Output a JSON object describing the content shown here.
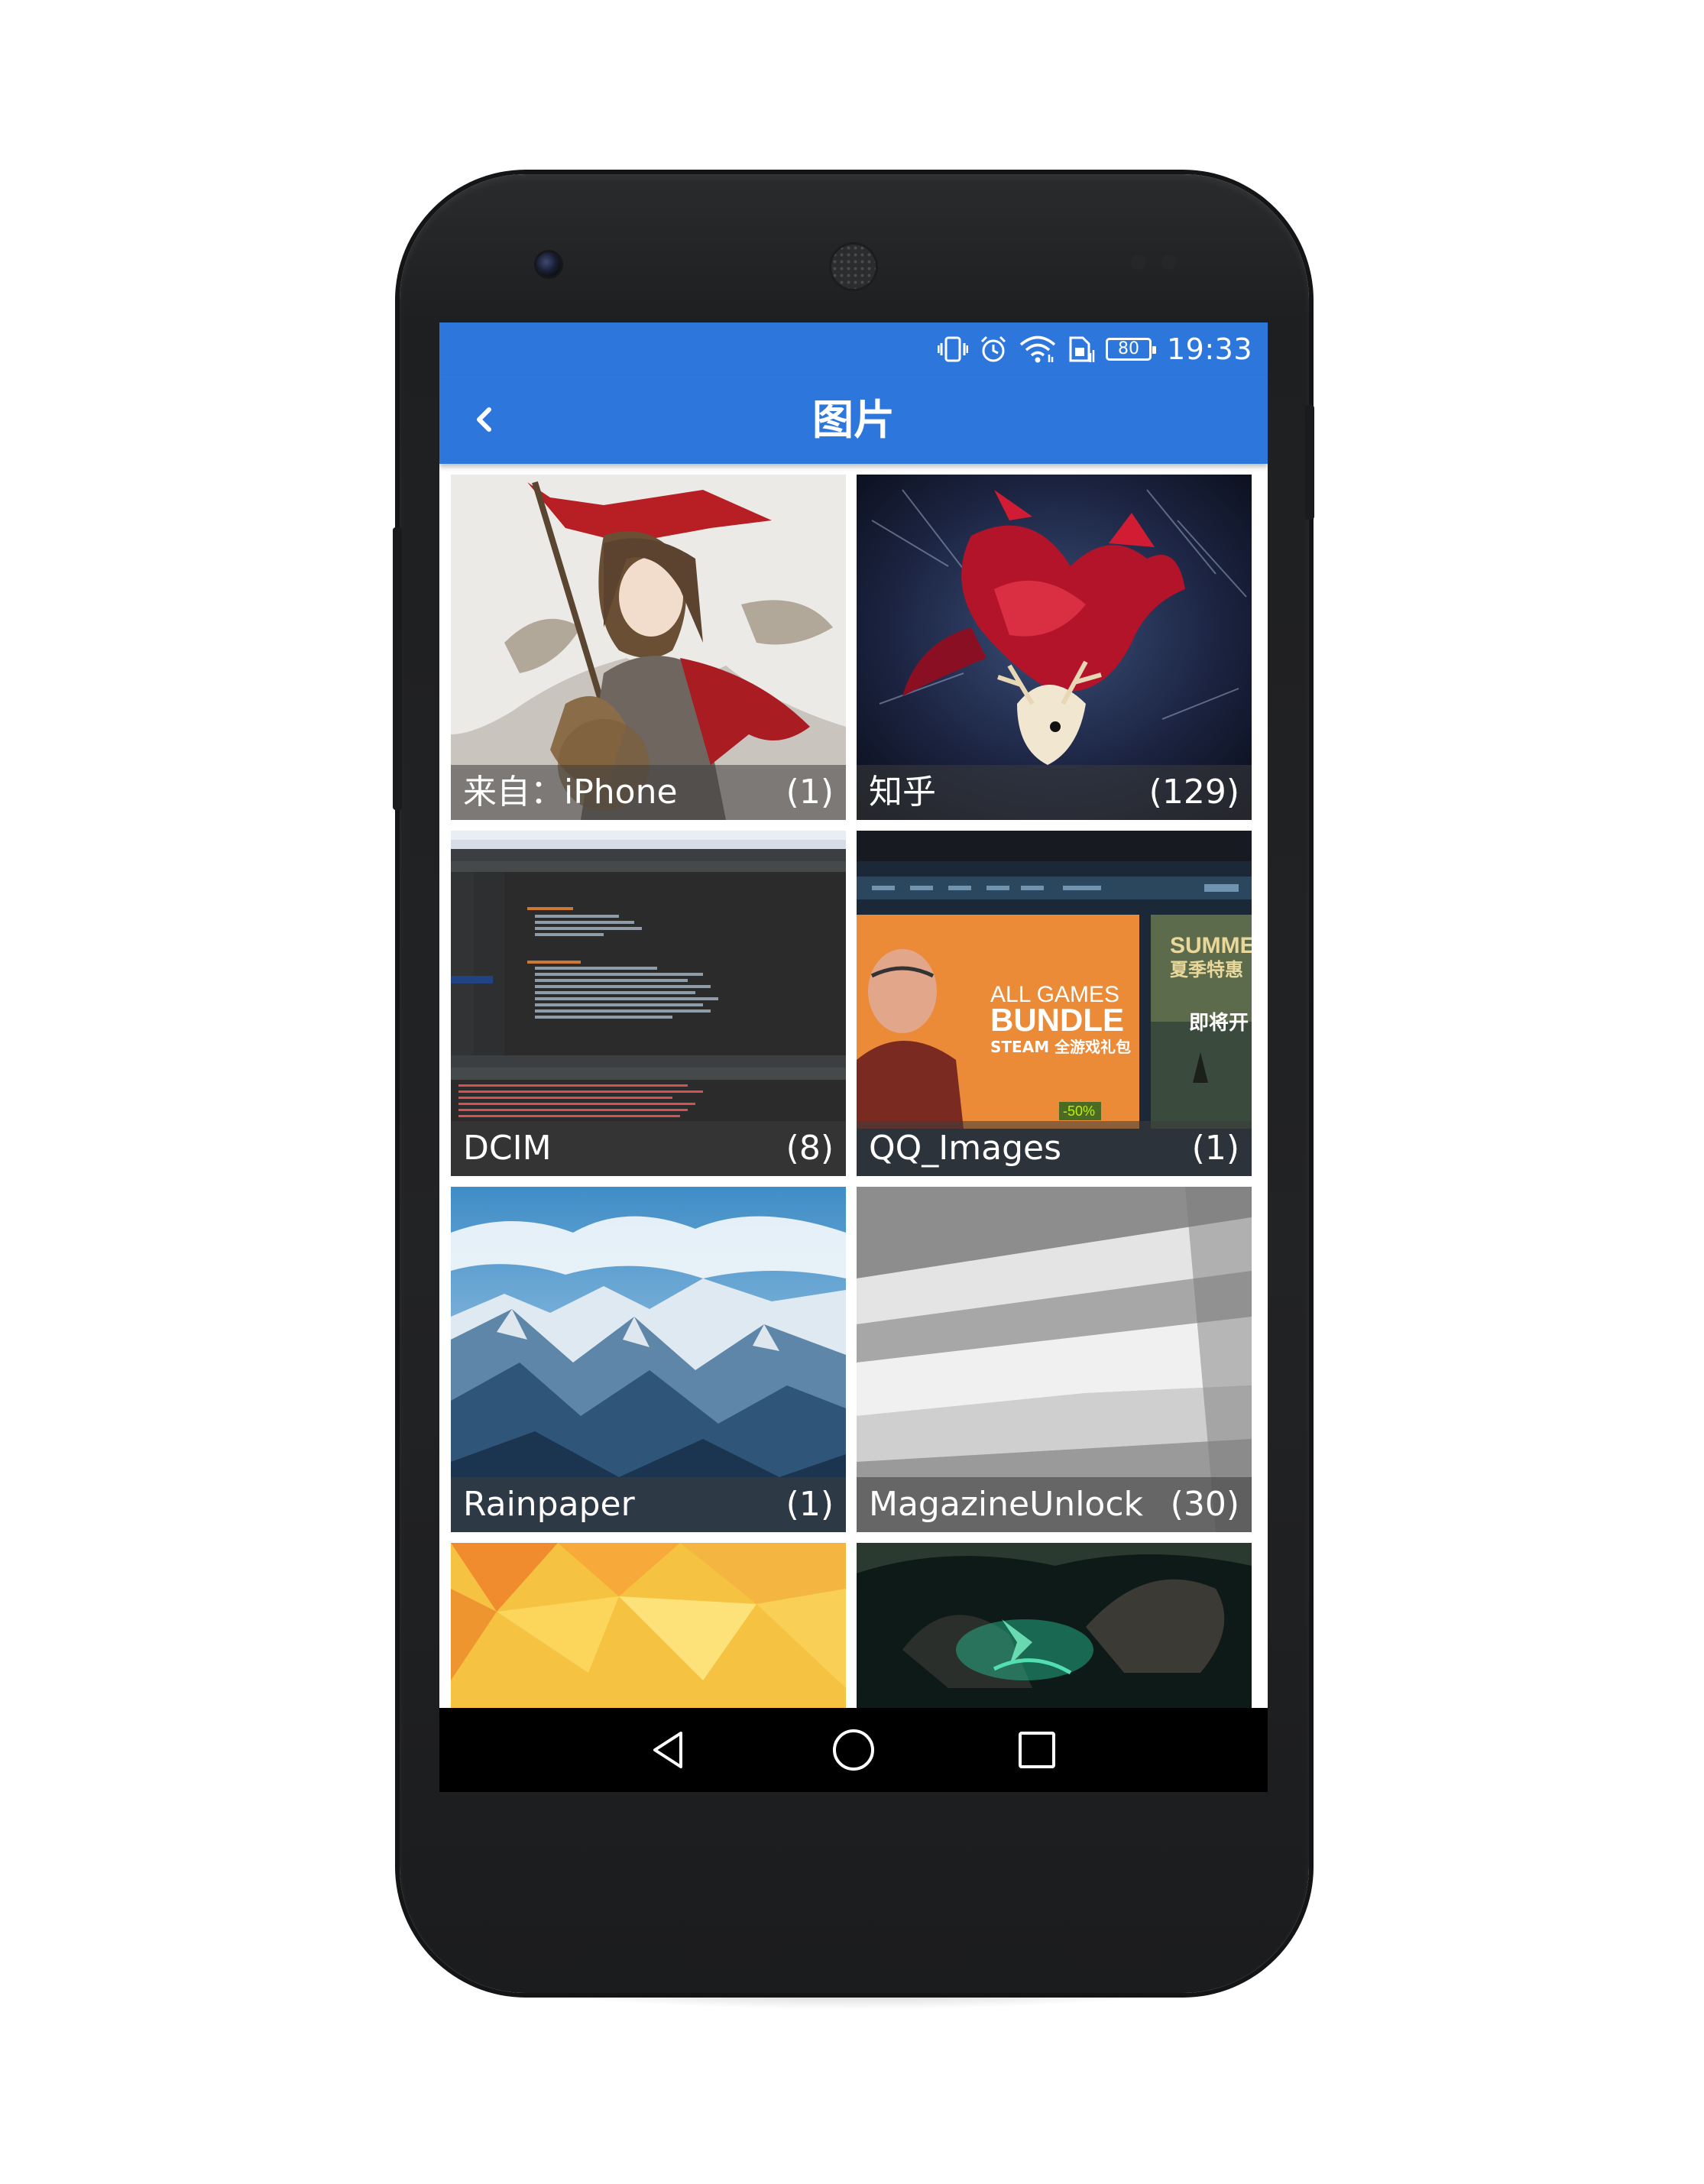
{
  "status_bar": {
    "battery_level": "80",
    "time": "19:33",
    "icons": [
      "vibrate-icon",
      "alarm-icon",
      "wifi-icon",
      "sim-card-icon",
      "battery-icon"
    ]
  },
  "app_bar": {
    "title": "图片",
    "back_icon": "chevron-left-icon"
  },
  "albums": [
    {
      "name": "来自：iPhone",
      "count": "(1)"
    },
    {
      "name": "知乎",
      "count": "(129)"
    },
    {
      "name": "DCIM",
      "count": "(8)"
    },
    {
      "name": "QQ_Images",
      "count": "(1)"
    },
    {
      "name": "Rainpaper",
      "count": "(1)"
    },
    {
      "name": "MagazineUnlock",
      "count": "(30)"
    },
    {
      "name": "",
      "count": ""
    },
    {
      "name": "",
      "count": ""
    }
  ],
  "steam_banner": {
    "line1": "ALL GAMES",
    "line2": "BUNDLE",
    "line3": "STEAM 全游戏礼包",
    "discount": "-50%",
    "side_title": "SUMMER",
    "side_subtitle": "夏季特惠",
    "side_cta": "即将开"
  },
  "nav_bar": {
    "icons": [
      "back-triangle-icon",
      "home-circle-icon",
      "recents-square-icon"
    ]
  },
  "colors": {
    "accent": "#2d77dc",
    "caption_bg": "rgba(60,60,60,0.55)"
  }
}
